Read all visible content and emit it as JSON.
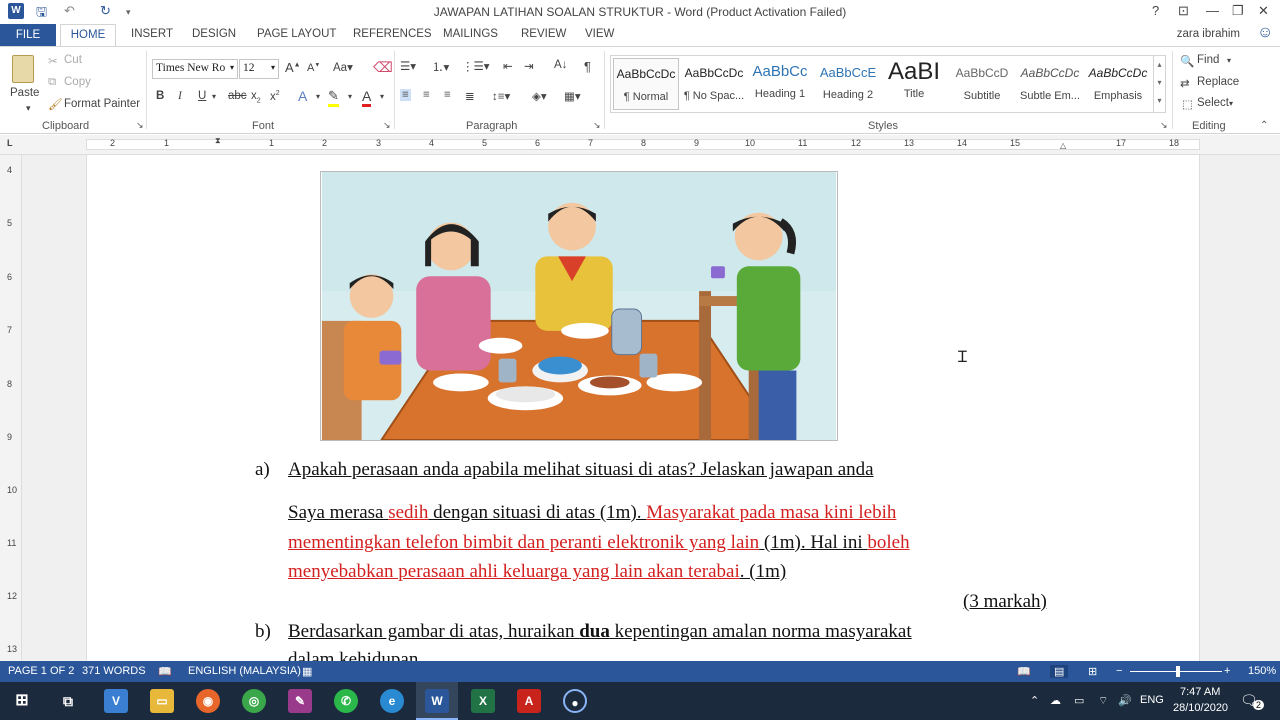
{
  "titlebar": {
    "title": "JAWAPAN LATIHAN SOALAN STRUKTUR - Word (Product Activation Failed)",
    "help": "?",
    "ribbon_opts": "⊡",
    "minimize": "—",
    "restore": "❐",
    "close": "✕"
  },
  "tabs": {
    "file": "FILE",
    "home": "HOME",
    "insert": "INSERT",
    "design": "DESIGN",
    "page_layout": "PAGE LAYOUT",
    "references": "REFERENCES",
    "mailings": "MAILINGS",
    "review": "REVIEW",
    "view": "VIEW",
    "user": "zara ibrahim"
  },
  "clipboard": {
    "paste": "Paste",
    "cut": "Cut",
    "copy": "Copy",
    "format_painter": "Format Painter",
    "group": "Clipboard"
  },
  "font": {
    "name": "Times New Ro",
    "size": "12",
    "group": "Font"
  },
  "paragraph": {
    "group": "Paragraph"
  },
  "styles": {
    "group": "Styles",
    "items": [
      {
        "preview": "AaBbCcDc",
        "name": "¶ Normal"
      },
      {
        "preview": "AaBbCcDc",
        "name": "¶ No Spac..."
      },
      {
        "preview": "AaBbCc",
        "name": "Heading 1"
      },
      {
        "preview": "AaBbCcE",
        "name": "Heading 2"
      },
      {
        "preview": "AaBI",
        "name": "Title"
      },
      {
        "preview": "AaBbCcD",
        "name": "Subtitle"
      },
      {
        "preview": "AaBbCcDc",
        "name": "Subtle Em..."
      },
      {
        "preview": "AaBbCcDc",
        "name": "Emphasis"
      }
    ]
  },
  "editing": {
    "find": "Find",
    "replace": "Replace",
    "select": "Select",
    "group": "Editing"
  },
  "ruler_h": [
    "2",
    "1",
    "",
    "1",
    "2",
    "3",
    "4",
    "5",
    "6",
    "7",
    "8",
    "9",
    "10",
    "11",
    "12",
    "13",
    "14",
    "15",
    "",
    "17",
    "18"
  ],
  "ruler_v": [
    "4",
    "5",
    "6",
    "7",
    "8",
    "9",
    "10",
    "11",
    "12",
    "13"
  ],
  "document": {
    "q_a_label": "a)",
    "q_a": "Apakah perasaan anda apabila melihat situasi di atas? Jelaskan jawapan anda",
    "ans_l1_a": "Saya merasa ",
    "ans_l1_b": "sedih",
    "ans_l1_c": " dengan situasi di atas (1m). ",
    "ans_l1_d": "Masyarakat pada masa kini lebih",
    "ans_l2_a": "mementingkan telefon bimbit dan peranti elektronik yang lain",
    "ans_l2_b": " (1m). Hal ini ",
    "ans_l2_c": "boleh",
    "ans_l3_a": "menyebabkan perasaan ahli keluarga yang lain akan terabai",
    "ans_l3_b": ". (1m)",
    "marks": "(3 markah)",
    "q_b_label": "b)",
    "q_b_1": "Berdasarkan gambar di atas, huraikan ",
    "q_b_bold": "dua",
    "q_b_2": " kepentingan amalan norma masyarakat",
    "q_b_3": "dalam kehidupan."
  },
  "status": {
    "page": "PAGE 1 OF 2",
    "words": "371 WORDS",
    "language": "ENGLISH (MALAYSIA)",
    "zoom": "150%"
  },
  "taskbar": {
    "lang": "ENG",
    "time": "7:47 AM",
    "date": "28/10/2020",
    "notif_count": "2"
  }
}
